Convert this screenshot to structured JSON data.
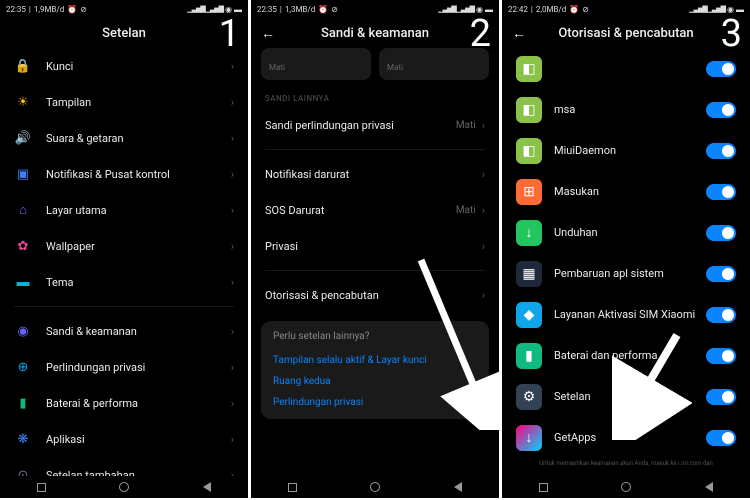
{
  "screen1": {
    "statusTime": "22:35",
    "statusNet": "1,9MB/d",
    "title": "Setelan",
    "num": "1",
    "items": [
      {
        "icon": "🔒",
        "color": "#888",
        "label": "Kunci"
      },
      {
        "icon": "☀",
        "color": "#ffb400",
        "label": "Tampilan"
      },
      {
        "icon": "🔊",
        "color": "#22c55e",
        "label": "Suara & getaran"
      },
      {
        "icon": "▣",
        "color": "#3b82f6",
        "label": "Notifikasi & Pusat kontrol"
      },
      {
        "icon": "⌂",
        "color": "#8b5cf6",
        "label": "Layar utama"
      },
      {
        "icon": "✿",
        "color": "#ec4899",
        "label": "Wallpaper"
      },
      {
        "icon": "▬",
        "color": "#06b6d4",
        "label": "Tema"
      }
    ],
    "items2": [
      {
        "icon": "◉",
        "color": "#6366f1",
        "label": "Sandi & keamanan"
      },
      {
        "icon": "⊕",
        "color": "#0ea5e9",
        "label": "Perlindungan privasi"
      },
      {
        "icon": "▮",
        "color": "#10b981",
        "label": "Baterai & performa"
      },
      {
        "icon": "❋",
        "color": "#3b82f6",
        "label": "Aplikasi"
      },
      {
        "icon": "⊙",
        "color": "#64748b",
        "label": "Setelan tambahan"
      }
    ]
  },
  "screen2": {
    "statusTime": "22:35",
    "statusNet": "1,3MB/d",
    "title": "Sandi & keamanan",
    "num": "2",
    "miniOff": "Mati",
    "section": "SANDI LAINNYA",
    "privacyRow": {
      "label": "Sandi perlindungan privasi",
      "val": "Mati"
    },
    "rows": [
      {
        "label": "Notifikasi darurat"
      },
      {
        "label": "SOS Darurat",
        "val": "Mati"
      },
      {
        "label": "Privasi"
      }
    ],
    "authRow": {
      "label": "Otorisasi & pencabutan"
    },
    "card": {
      "q": "Perlu setelan lainnya?",
      "links": [
        "Tampilan selalu aktif & Layar kunci",
        "Ruang kedua",
        "Perlindungan privasi"
      ]
    }
  },
  "screen3": {
    "statusTime": "22:42",
    "statusNet": "2,0MB/d",
    "title": "Otorisasi & pencabutan",
    "num": "3",
    "apps": [
      {
        "bg": "#8bc34a",
        "glyph": "◧",
        "label": ""
      },
      {
        "bg": "#8bc34a",
        "glyph": "◧",
        "label": "msa"
      },
      {
        "bg": "#8bc34a",
        "glyph": "◧",
        "label": "MiuiDaemon"
      },
      {
        "bg": "#ff6b35",
        "glyph": "⊞",
        "label": "Masukan"
      },
      {
        "bg": "#22c55e",
        "glyph": "↓",
        "label": "Unduhan"
      },
      {
        "bg": "#1e293b",
        "glyph": "▦",
        "label": "Pembaruan apl sistem"
      },
      {
        "bg": "#0ea5e9",
        "glyph": "◆",
        "label": "Layanan Aktivasi SIM Xiaomi"
      },
      {
        "bg": "#10b981",
        "glyph": "▮",
        "label": "Baterai dan performa"
      },
      {
        "bg": "#334155",
        "glyph": "⚙",
        "label": "Setelan"
      },
      {
        "bg": "linear-gradient(135deg,#ff0080,#00d4ff)",
        "glyph": "↓",
        "label": "GetApps"
      }
    ],
    "foot": "Untuk memastikan keamanan akun Anda, masuk ke i.mi.com dan"
  }
}
